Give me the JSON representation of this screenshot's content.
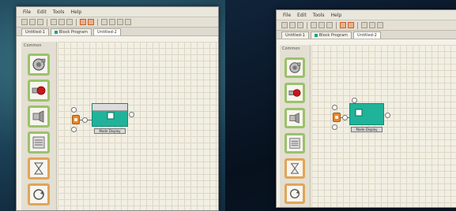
{
  "menu": [
    "File",
    "Edit",
    "Tools",
    "Help"
  ],
  "tabs": [
    "Untitled-1",
    "Block Program",
    "Untitled-2"
  ],
  "palette_label": "Common",
  "block_label": "Mode Display"
}
